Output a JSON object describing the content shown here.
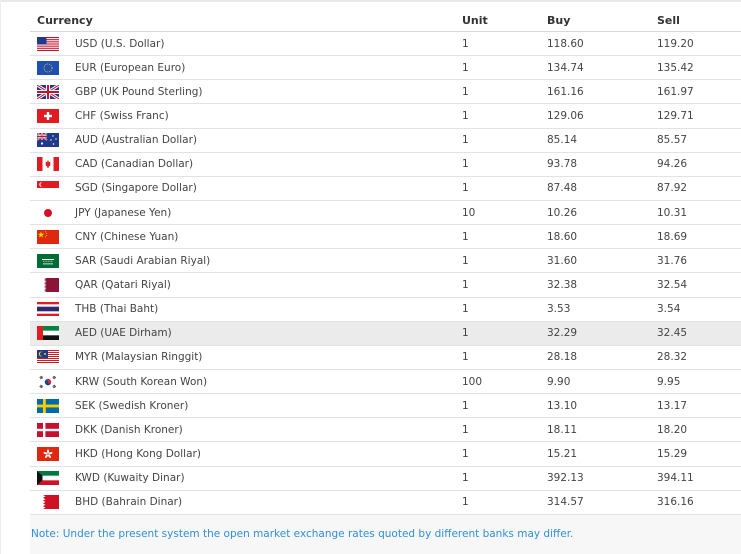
{
  "table": {
    "headers": {
      "currency": "Currency",
      "unit": "Unit",
      "buy": "Buy",
      "sell": "Sell"
    },
    "rows": [
      {
        "flag": "usa-flag-icon",
        "name": "USD (U.S. Dollar)",
        "unit": "1",
        "buy": "118.60",
        "sell": "119.20"
      },
      {
        "flag": "eu-flag-icon",
        "name": "EUR (European Euro)",
        "unit": "1",
        "buy": "134.74",
        "sell": "135.42"
      },
      {
        "flag": "uk-flag-icon",
        "name": "GBP (UK Pound Sterling)",
        "unit": "1",
        "buy": "161.16",
        "sell": "161.97"
      },
      {
        "flag": "switzerland-flag-icon",
        "name": "CHF (Swiss Franc)",
        "unit": "1",
        "buy": "129.06",
        "sell": "129.71"
      },
      {
        "flag": "australia-flag-icon",
        "name": "AUD (Australian Dollar)",
        "unit": "1",
        "buy": "85.14",
        "sell": "85.57"
      },
      {
        "flag": "canada-flag-icon",
        "name": "CAD (Canadian Dollar)",
        "unit": "1",
        "buy": "93.78",
        "sell": "94.26"
      },
      {
        "flag": "singapore-flag-icon",
        "name": "SGD (Singapore Dollar)",
        "unit": "1",
        "buy": "87.48",
        "sell": "87.92"
      },
      {
        "flag": "japan-flag-icon",
        "name": "JPY (Japanese Yen)",
        "unit": "10",
        "buy": "10.26",
        "sell": "10.31"
      },
      {
        "flag": "china-flag-icon",
        "name": "CNY (Chinese Yuan)",
        "unit": "1",
        "buy": "18.60",
        "sell": "18.69"
      },
      {
        "flag": "saudi-arabia-flag-icon",
        "name": "SAR (Saudi Arabian Riyal)",
        "unit": "1",
        "buy": "31.60",
        "sell": "31.76"
      },
      {
        "flag": "qatar-flag-icon",
        "name": "QAR (Qatari Riyal)",
        "unit": "1",
        "buy": "32.38",
        "sell": "32.54"
      },
      {
        "flag": "thailand-flag-icon",
        "name": "THB (Thai Baht)",
        "unit": "1",
        "buy": "3.53",
        "sell": "3.54"
      },
      {
        "flag": "uae-flag-icon",
        "name": "AED (UAE Dirham)",
        "unit": "1",
        "buy": "32.29",
        "sell": "32.45",
        "highlighted": true
      },
      {
        "flag": "malaysia-flag-icon",
        "name": "MYR (Malaysian Ringgit)",
        "unit": "1",
        "buy": "28.18",
        "sell": "28.32"
      },
      {
        "flag": "south-korea-flag-icon",
        "name": "KRW (South Korean Won)",
        "unit": "100",
        "buy": "9.90",
        "sell": "9.95"
      },
      {
        "flag": "sweden-flag-icon",
        "name": "SEK (Swedish Kroner)",
        "unit": "1",
        "buy": "13.10",
        "sell": "13.17"
      },
      {
        "flag": "denmark-flag-icon",
        "name": "DKK (Danish Kroner)",
        "unit": "1",
        "buy": "18.11",
        "sell": "18.20"
      },
      {
        "flag": "hong-kong-flag-icon",
        "name": "HKD (Hong Kong Dollar)",
        "unit": "1",
        "buy": "15.21",
        "sell": "15.29"
      },
      {
        "flag": "kuwait-flag-icon",
        "name": "KWD (Kuwaity Dinar)",
        "unit": "1",
        "buy": "392.13",
        "sell": "394.11"
      },
      {
        "flag": "bahrain-flag-icon",
        "name": "BHD (Bahrain Dinar)",
        "unit": "1",
        "buy": "314.57",
        "sell": "316.16"
      }
    ]
  },
  "note": "Note: Under the present system the open market exchange rates quoted by different banks may differ.",
  "colors": {
    "note_text": "#2f8fd8",
    "highlight_row": "#ebebeb",
    "panel_bg": "#f7f7f7"
  }
}
